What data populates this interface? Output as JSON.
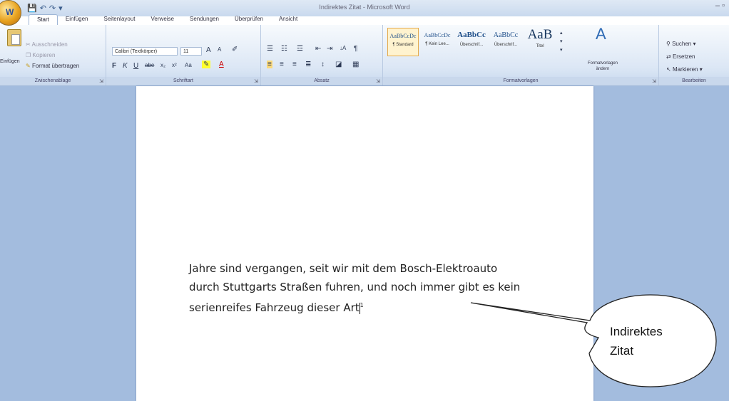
{
  "window": {
    "title": "Indirektes Zitat - Microsoft Word",
    "controls": "– ▫"
  },
  "quick_access": {
    "save": "💾",
    "undo": "↶",
    "redo": "↷",
    "more": "▾"
  },
  "tabs": [
    {
      "label": "Start",
      "active": true
    },
    {
      "label": "Einfügen"
    },
    {
      "label": "Seitenlayout"
    },
    {
      "label": "Verweise"
    },
    {
      "label": "Sendungen"
    },
    {
      "label": "Überprüfen"
    },
    {
      "label": "Ansicht"
    }
  ],
  "ribbon": {
    "clipboard": {
      "label": "Zwischenablage",
      "paste": "Einfügen",
      "cut": "Ausschneiden",
      "copy": "Kopieren",
      "format_painter": "Format übertragen"
    },
    "font": {
      "label": "Schriftart",
      "font_name": "Calibri (Textkörper)",
      "font_size": "11"
    },
    "paragraph": {
      "label": "Absatz"
    },
    "styles": {
      "label": "Formatvorlagen",
      "items": [
        {
          "sample": "AaBbCcDc",
          "name": "¶ Standard",
          "selected": true
        },
        {
          "sample": "AaBbCcDc",
          "name": "¶ Kein Lee..."
        },
        {
          "sample": "AaBbCc",
          "name": "Überschrif..."
        },
        {
          "sample": "AaBbCc",
          "name": "Überschrif..."
        },
        {
          "sample": "AaB",
          "name": "Titel"
        }
      ],
      "change_styles": "Formatvorlagen ändern"
    },
    "editing": {
      "label": "Bearbeiten",
      "find": "Suchen",
      "replace": "Ersetzen",
      "select": "Markieren"
    }
  },
  "document": {
    "line1": "Jahre sind vergangen, seit wir mit dem Bosch-Elektroauto",
    "line2": "durch Stuttgarts Straßen fuhren, und noch immer gibt es kein",
    "line3": "serienreifes Fahrzeug dieser Art",
    "footnote": "1"
  },
  "callout": {
    "line1": "Indirektes",
    "line2": "Zitat"
  }
}
